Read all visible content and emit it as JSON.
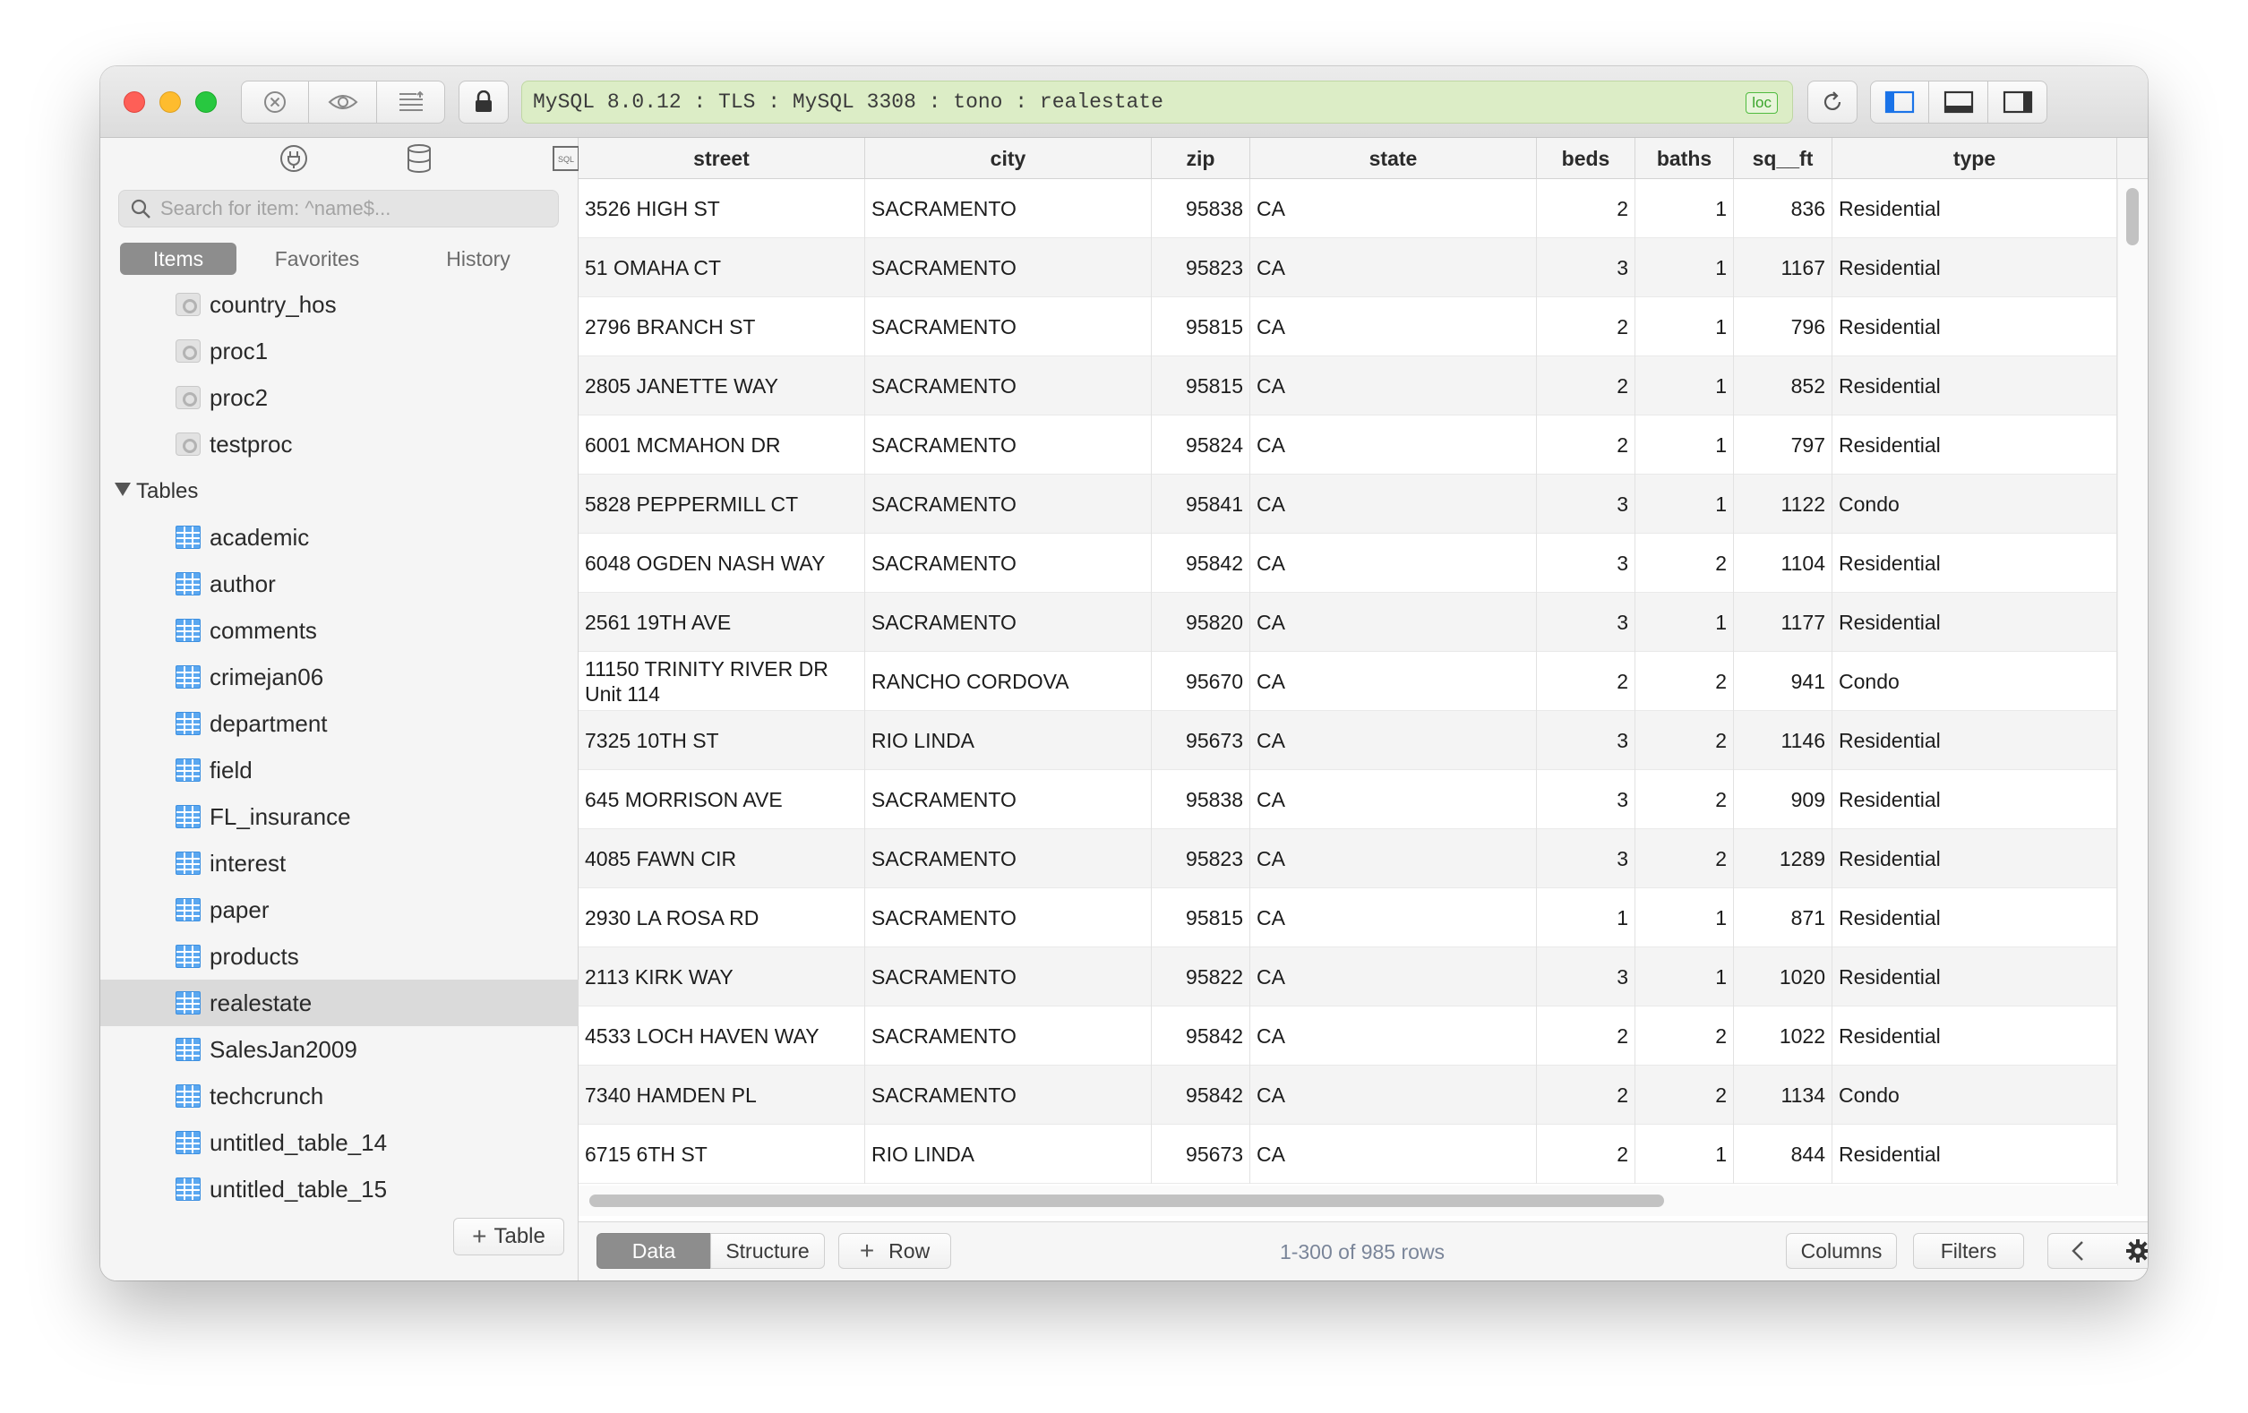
{
  "connection": {
    "text": "MySQL 8.0.12 : TLS : MySQL 3308 : tono : realestate",
    "badge": "loc"
  },
  "sidebar": {
    "search_placeholder": "Search for item: ^name$...",
    "tabs": {
      "items": "Items",
      "favorites": "Favorites",
      "history": "History"
    },
    "procedures": [
      "country_hos",
      "proc1",
      "proc2",
      "testproc"
    ],
    "tables_group": "Tables",
    "tables": [
      "academic",
      "author",
      "comments",
      "crimejan06",
      "department",
      "field",
      "FL_insurance",
      "interest",
      "paper",
      "products",
      "realestate",
      "SalesJan2009",
      "techcrunch",
      "untitled_table_14",
      "untitled_table_15"
    ],
    "selected_table": "realestate",
    "add_table_label": "Table"
  },
  "grid": {
    "columns": [
      "street",
      "city",
      "zip",
      "state",
      "beds",
      "baths",
      "sq__ft",
      "type"
    ],
    "rows": [
      [
        "3526 HIGH ST",
        "SACRAMENTO",
        "95838",
        "CA",
        "2",
        "1",
        "836",
        "Residential"
      ],
      [
        "51 OMAHA CT",
        "SACRAMENTO",
        "95823",
        "CA",
        "3",
        "1",
        "1167",
        "Residential"
      ],
      [
        "2796 BRANCH ST",
        "SACRAMENTO",
        "95815",
        "CA",
        "2",
        "1",
        "796",
        "Residential"
      ],
      [
        "2805 JANETTE WAY",
        "SACRAMENTO",
        "95815",
        "CA",
        "2",
        "1",
        "852",
        "Residential"
      ],
      [
        "6001 MCMAHON DR",
        "SACRAMENTO",
        "95824",
        "CA",
        "2",
        "1",
        "797",
        "Residential"
      ],
      [
        "5828 PEPPERMILL CT",
        "SACRAMENTO",
        "95841",
        "CA",
        "3",
        "1",
        "1122",
        "Condo"
      ],
      [
        "6048 OGDEN NASH WAY",
        "SACRAMENTO",
        "95842",
        "CA",
        "3",
        "2",
        "1104",
        "Residential"
      ],
      [
        "2561 19TH AVE",
        "SACRAMENTO",
        "95820",
        "CA",
        "3",
        "1",
        "1177",
        "Residential"
      ],
      [
        "11150 TRINITY RIVER DR\nUnit 114",
        "RANCHO CORDOVA",
        "95670",
        "CA",
        "2",
        "2",
        "941",
        "Condo"
      ],
      [
        "7325 10TH ST",
        "RIO LINDA",
        "95673",
        "CA",
        "3",
        "2",
        "1146",
        "Residential"
      ],
      [
        "645 MORRISON AVE",
        "SACRAMENTO",
        "95838",
        "CA",
        "3",
        "2",
        "909",
        "Residential"
      ],
      [
        "4085 FAWN CIR",
        "SACRAMENTO",
        "95823",
        "CA",
        "3",
        "2",
        "1289",
        "Residential"
      ],
      [
        "2930 LA ROSA RD",
        "SACRAMENTO",
        "95815",
        "CA",
        "1",
        "1",
        "871",
        "Residential"
      ],
      [
        "2113 KIRK WAY",
        "SACRAMENTO",
        "95822",
        "CA",
        "3",
        "1",
        "1020",
        "Residential"
      ],
      [
        "4533 LOCH HAVEN WAY",
        "SACRAMENTO",
        "95842",
        "CA",
        "2",
        "2",
        "1022",
        "Residential"
      ],
      [
        "7340 HAMDEN PL",
        "SACRAMENTO",
        "95842",
        "CA",
        "2",
        "2",
        "1134",
        "Condo"
      ],
      [
        "6715 6TH ST",
        "RIO LINDA",
        "95673",
        "CA",
        "2",
        "1",
        "844",
        "Residential"
      ]
    ]
  },
  "bottom_bar": {
    "data_tab": "Data",
    "structure_tab": "Structure",
    "row_label": "Row",
    "row_count": "1-300 of 985 rows",
    "columns_label": "Columns",
    "filters_label": "Filters"
  }
}
